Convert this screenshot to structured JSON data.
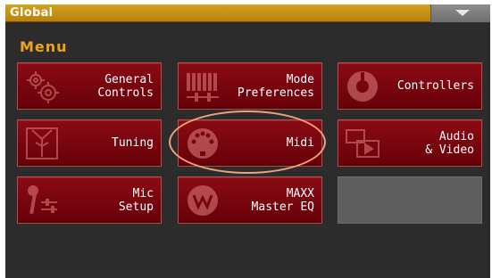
{
  "window": {
    "title": "Global"
  },
  "menu": {
    "heading": "Menu"
  },
  "tiles": [
    {
      "label": "General\nControls",
      "icon": "gears-icon"
    },
    {
      "label": "Mode\nPreferences",
      "icon": "keyboard-sliders-icon"
    },
    {
      "label": "Controllers",
      "icon": "knob-icon"
    },
    {
      "label": "Tuning",
      "icon": "tuning-fork-icon"
    },
    {
      "label": "Midi",
      "icon": "midi-connector-icon"
    },
    {
      "label": "Audio\n& Video",
      "icon": "audio-video-icon"
    },
    {
      "label": "Mic\nSetup",
      "icon": "microphone-icon"
    },
    {
      "label": "MAXX\nMaster EQ",
      "icon": "maxx-eq-icon"
    }
  ],
  "colors": {
    "title_bar": "#c8901a",
    "heading": "#f0a21a",
    "tile": "#7a0410",
    "highlight": "#f2a27a",
    "screen_bg": "#2c2c2c"
  }
}
